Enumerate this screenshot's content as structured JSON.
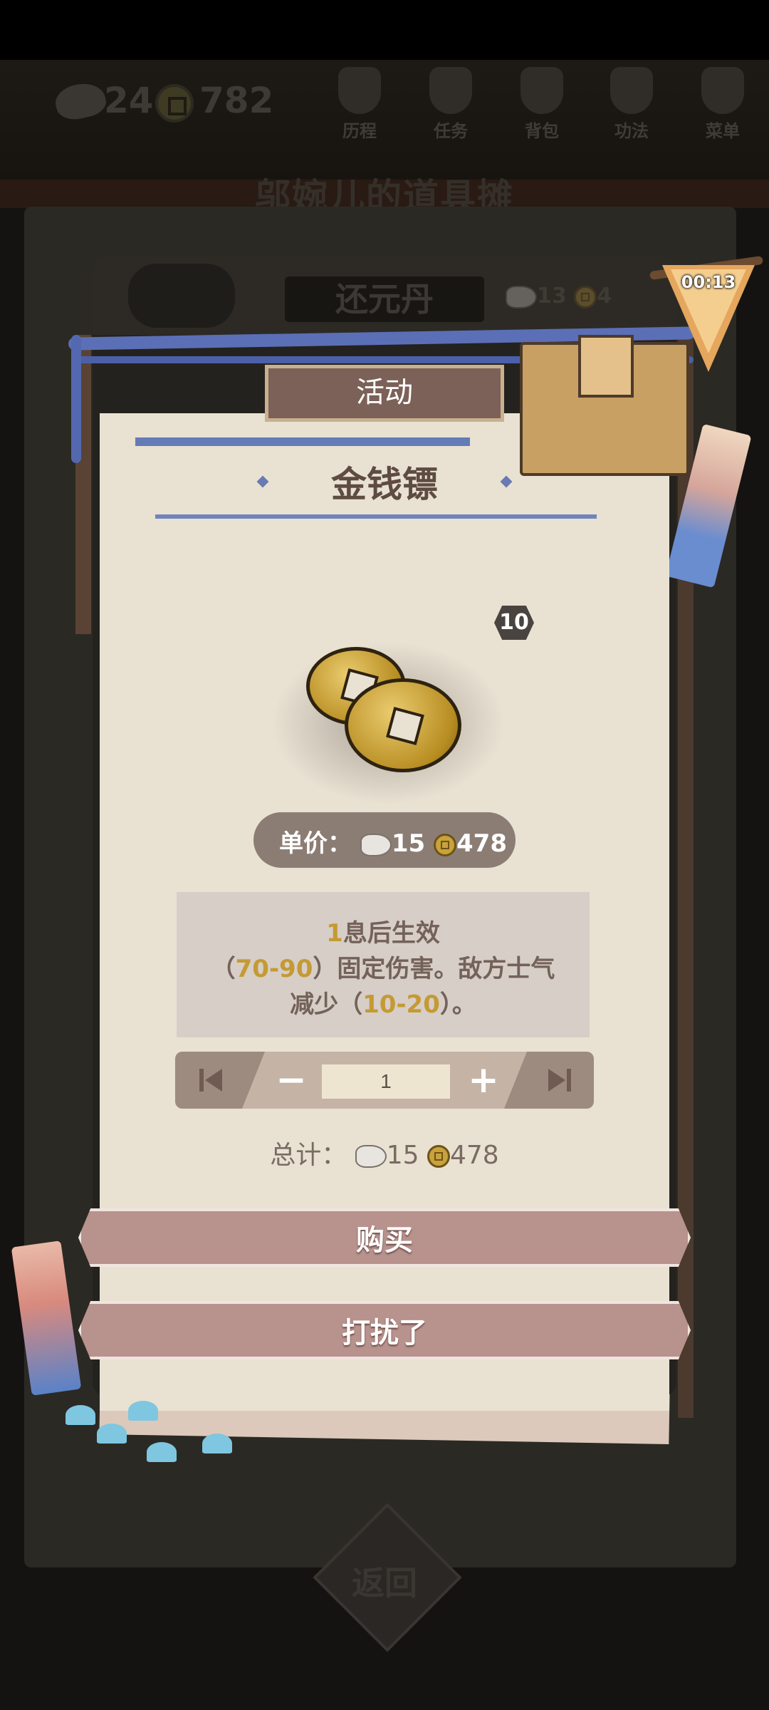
{
  "hud": {
    "silver": "24",
    "coins": "782",
    "nav": [
      {
        "label": "历程",
        "icon": "history-icon"
      },
      {
        "label": "任务",
        "icon": "task-icon"
      },
      {
        "label": "背包",
        "icon": "bag-icon"
      },
      {
        "label": "功法",
        "icon": "scroll-icon"
      },
      {
        "label": "菜单",
        "icon": "menu-fan-icon"
      }
    ]
  },
  "stall": {
    "title": "邬婉儿的道具摊",
    "background_item": {
      "name": "还元丹",
      "silver": "13",
      "coins": "4"
    },
    "timer": "00:13"
  },
  "detail": {
    "tag": "活动",
    "item_name": "金钱镖",
    "count": "10",
    "unit_price_label": "单价：",
    "unit_silver": "15",
    "unit_coins": "478",
    "desc": {
      "line1_num": "1",
      "line1_text": "息后生效",
      "line2_open": "（",
      "line2_range": "70-90",
      "line2_text": "）固定伤害。敌方士气",
      "line3_pre": "减少（",
      "line3_range": "10-20",
      "line3_post": "）。"
    },
    "quantity": "1",
    "minus_label": "−",
    "plus_label": "+",
    "total_label": "总计：",
    "total_silver": "15",
    "total_coins": "478",
    "buy_label": "购买",
    "leave_label": "打扰了"
  },
  "footer": {
    "return_label": "返回"
  },
  "colors": {
    "accent_gold": "#c59a34",
    "paper": "#e9e2d3",
    "button": "#b8928d"
  }
}
